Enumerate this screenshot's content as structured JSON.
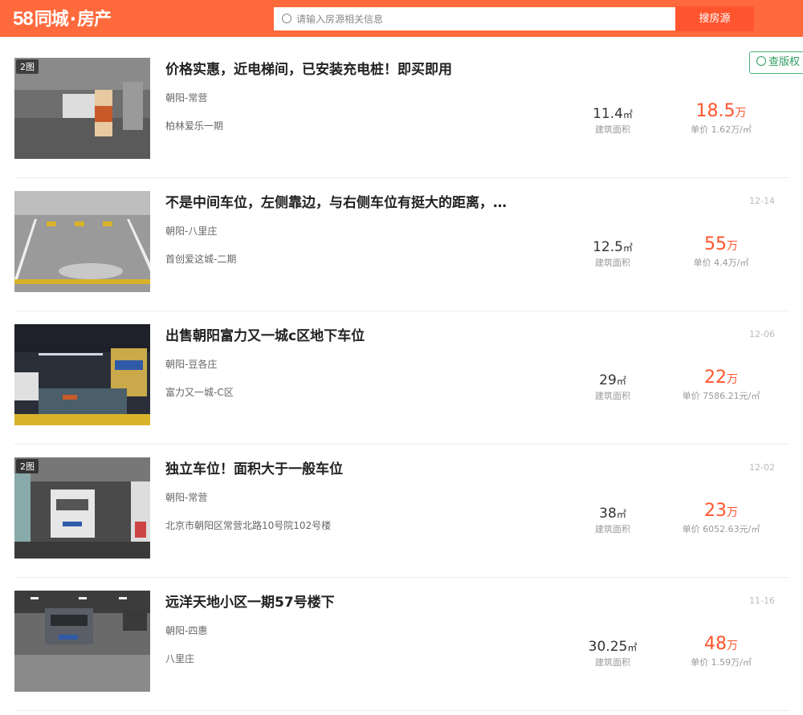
{
  "header": {
    "logo_num": "58",
    "logo_text": "同城",
    "logo_dot": "·",
    "logo_section": "房产",
    "search_placeholder": "请输入房源相关信息",
    "search_button": "搜房源",
    "brand_color": "#ff6a3d"
  },
  "side_button": {
    "label": "查版权"
  },
  "listings": [
    {
      "title": "价格实惠，近电梯间，已安装充电桩！即买即用",
      "district": "朝阳-常营",
      "address": "柏林爱乐一期",
      "date": "",
      "pic_count": "2图",
      "area_value": "11.4",
      "area_unit": "㎡",
      "area_label": "建筑面积",
      "price_value": "18.5",
      "price_unit": "万",
      "unit_price": "单价  1.62万/㎡"
    },
    {
      "title": "不是中间车位，左侧靠边，与右侧车位有挺大的距离，…",
      "district": "朝阳-八里庄",
      "address": "首创爱这城-二期",
      "date": "12-14",
      "pic_count": "",
      "area_value": "12.5",
      "area_unit": "㎡",
      "area_label": "建筑面积",
      "price_value": "55",
      "price_unit": "万",
      "unit_price": "单价  4.4万/㎡"
    },
    {
      "title": "出售朝阳富力又一城c区地下车位",
      "district": "朝阳-豆各庄",
      "address": "富力又一城-C区",
      "date": "12-06",
      "pic_count": "",
      "area_value": "29",
      "area_unit": "㎡",
      "area_label": "建筑面积",
      "price_value": "22",
      "price_unit": "万",
      "unit_price": "单价  7586.21元/㎡"
    },
    {
      "title": "独立车位！面积大于一般车位",
      "district": "朝阳-常营",
      "address": "北京市朝阳区常营北路10号院102号楼",
      "date": "12-02",
      "pic_count": "2图",
      "area_value": "38",
      "area_unit": "㎡",
      "area_label": "建筑面积",
      "price_value": "23",
      "price_unit": "万",
      "unit_price": "单价  6052.63元/㎡"
    },
    {
      "title": "远洋天地小区一期57号楼下",
      "district": "朝阳-四惠",
      "address": "八里庄",
      "date": "11-16",
      "pic_count": "",
      "area_value": "30.25",
      "area_unit": "㎡",
      "area_label": "建筑面积",
      "price_value": "48",
      "price_unit": "万",
      "unit_price": "单价  1.59万/㎡"
    }
  ]
}
